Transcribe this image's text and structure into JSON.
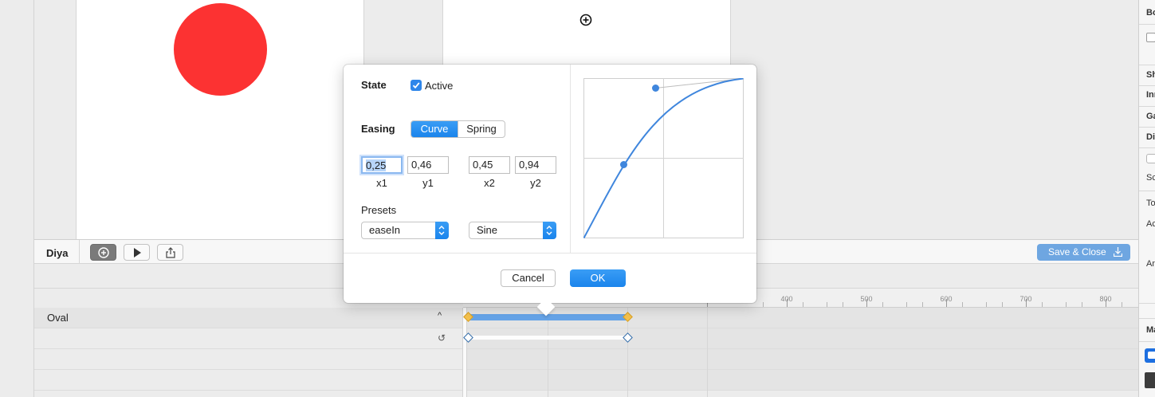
{
  "timeline": {
    "project_name": "Diya",
    "add_icon": "plus-circle-icon",
    "play_icon": "play-icon",
    "export_icon": "share-icon",
    "save_close_label": "Save & Close",
    "ruler_ticks": [
      "400",
      "500",
      "600",
      "700",
      "800"
    ],
    "tracks": [
      {
        "label": "Oval",
        "action_icon": "chevron-up-icon",
        "action_glyph": "^"
      },
      {
        "label": "",
        "action_icon": "reset-icon",
        "action_glyph": "↺"
      }
    ]
  },
  "popover": {
    "state_label": "State",
    "active_label": "Active",
    "active_checked": true,
    "easing_label": "Easing",
    "easing_modes": [
      "Curve",
      "Spring"
    ],
    "easing_selected": "Curve",
    "bezier": {
      "x1": {
        "value": "0,25",
        "caption": "x1"
      },
      "y1": {
        "value": "0,46",
        "caption": "y1"
      },
      "x2": {
        "value": "0,45",
        "caption": "x2"
      },
      "y2": {
        "value": "0,94",
        "caption": "y2"
      }
    },
    "presets_label": "Presets",
    "preset_easing": "easeIn",
    "preset_curve": "Sine",
    "cancel_label": "Cancel",
    "ok_label": "OK"
  },
  "inspector": {
    "rows": [
      "Bo",
      "Sh",
      "Inn",
      "Ga",
      "Di",
      "Sc",
      "To",
      "Ac",
      "An",
      "Ma"
    ]
  },
  "colors": {
    "oval_fill": "#fc3232",
    "accent_blue": "#1a84ec",
    "keyframe_orange": "#f5c24e",
    "animation_bar": "#66a4e8"
  }
}
